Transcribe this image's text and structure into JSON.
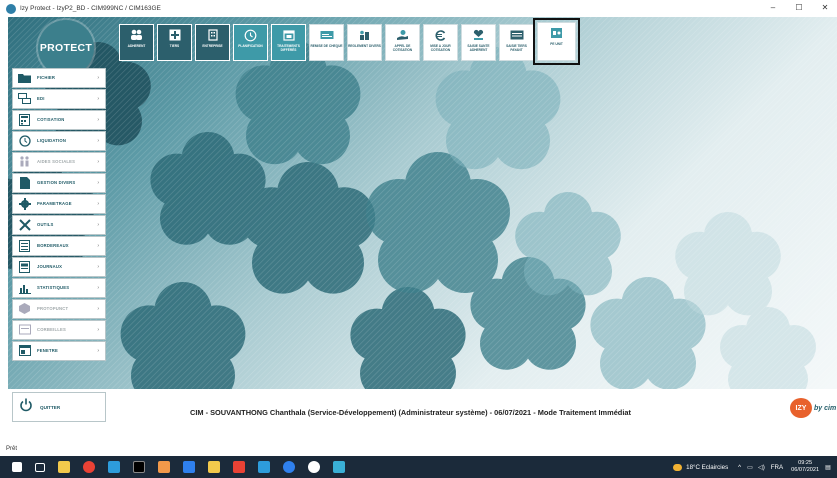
{
  "window": {
    "title": "Izy Protect - IzyP2_BD - CIM999NC / CIM163GE",
    "controls": [
      "–",
      "☐",
      "✕"
    ]
  },
  "logo": {
    "text": "PROTECT"
  },
  "toolbar": {
    "buttons": [
      {
        "label": "ADHERENT",
        "icon": "people-icon",
        "style": "dark"
      },
      {
        "label": "TIERS",
        "icon": "plus-square-icon",
        "style": "dark"
      },
      {
        "label": "ENTREPRISE",
        "icon": "building-icon",
        "style": "dark"
      },
      {
        "label": "PLANIFICATION",
        "icon": "clock-icon",
        "style": "teal"
      },
      {
        "label": "TRAITEMENTS DIFFÉRÉS",
        "icon": "calendar-icon",
        "style": "teal"
      },
      {
        "label": "REMISE DE CHEQUE",
        "icon": "cheque-icon",
        "style": "light"
      },
      {
        "label": "REGLEMENT DIVERS",
        "icon": "coins-icon",
        "style": "light"
      },
      {
        "label": "APPEL DE COTISATION",
        "icon": "hand-coin-icon",
        "style": "light"
      },
      {
        "label": "MISE A JOUR COTISATION",
        "icon": "euro-refresh-icon",
        "style": "light"
      },
      {
        "label": "SAISIE SANTE ADHERENT",
        "icon": "heart-hand-icon",
        "style": "light"
      },
      {
        "label": "SAISIE TIERS PAYANT",
        "icon": "tiers-payant-icon",
        "style": "light"
      },
      {
        "label": "PE UNIT",
        "icon": "pe-unit-icon",
        "style": "light",
        "selected": true
      }
    ]
  },
  "sidemenu": {
    "items": [
      {
        "label": "FICHIER",
        "icon": "folder-icon",
        "enabled": true
      },
      {
        "label": "EDI",
        "icon": "network-icon",
        "enabled": true
      },
      {
        "label": "COTISATION",
        "icon": "calculator-icon",
        "enabled": true
      },
      {
        "label": "LIQUIDATION",
        "icon": "clock-icon",
        "enabled": true
      },
      {
        "label": "AIDES SOCIALES",
        "icon": "family-icon",
        "enabled": false
      },
      {
        "label": "GESTION DIVERS",
        "icon": "document-icon",
        "enabled": true
      },
      {
        "label": "PARAMETRAGE",
        "icon": "gear-icon",
        "enabled": true
      },
      {
        "label": "OUTILS",
        "icon": "tools-icon",
        "enabled": true
      },
      {
        "label": "BORDEREAUX",
        "icon": "list-icon",
        "enabled": true
      },
      {
        "label": "JOURNAUX",
        "icon": "journal-icon",
        "enabled": true
      },
      {
        "label": "STATISTIQUES",
        "icon": "bar-chart-icon",
        "enabled": true
      },
      {
        "label": "PROTOPUNCT",
        "icon": "cube-icon",
        "enabled": false
      },
      {
        "label": "CORBEILLES",
        "icon": "tray-icon",
        "enabled": false
      },
      {
        "label": "FENETRE",
        "icon": "window-icon",
        "enabled": true
      }
    ],
    "quit_label": "QUITTER"
  },
  "status": {
    "info": "CIM - SOUVANTHONG Chanthala (Service-Développement) (Administrateur système) - 06/07/2021 - Mode Traitement Immédiat",
    "ready": "Prêt"
  },
  "brand": {
    "logo_text": "IZY",
    "by_text": "by cim"
  },
  "taskbar": {
    "weather": "18°C Eclaircies",
    "language": "FRA",
    "time": "09:25",
    "date": "06/07/2021",
    "app_colors": [
      "#ffffff",
      "#ffffff",
      "#f2c94c",
      "#e94235",
      "#2d9cdb",
      "#000000",
      "#f2994a",
      "#2f80ed",
      "#f2c94c",
      "#e94235",
      "#2d9cdb",
      "#2f80ed",
      "#ffffff",
      "#3ab0d6"
    ]
  },
  "colors": {
    "primary": "#2c5f6c",
    "accent": "#3e9aa8",
    "brand_orange": "#e8612c"
  }
}
